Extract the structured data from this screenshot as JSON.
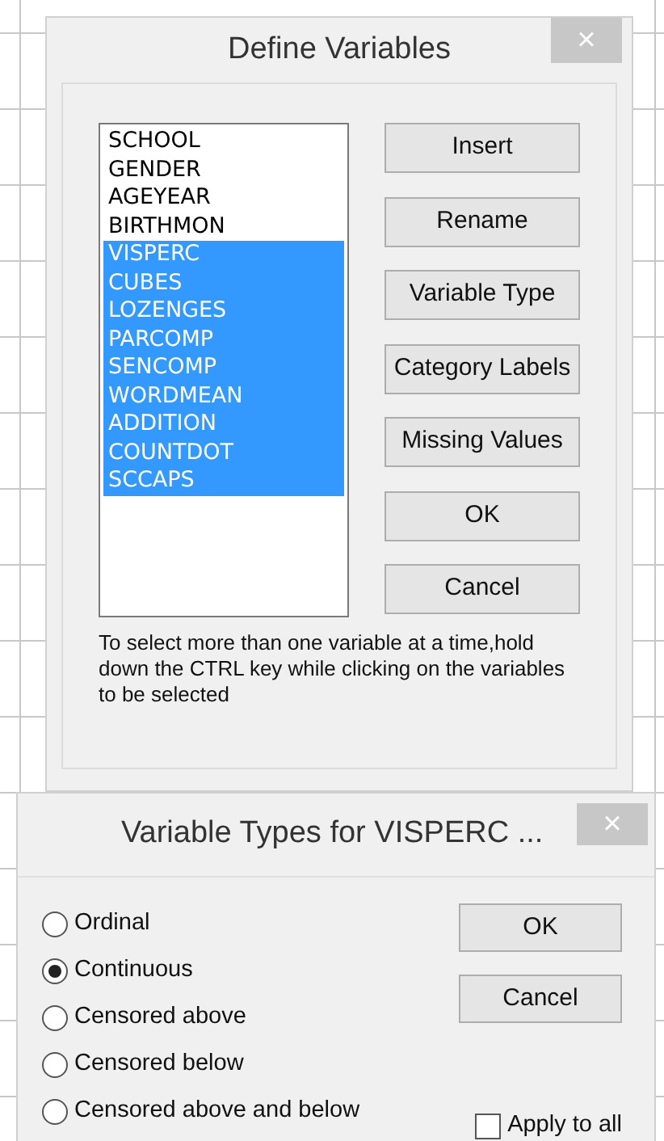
{
  "define_dialog": {
    "title": "Define Variables",
    "close": "×",
    "variables": [
      {
        "name": "SCHOOL",
        "selected": false
      },
      {
        "name": "GENDER",
        "selected": false
      },
      {
        "name": "AGEYEAR",
        "selected": false
      },
      {
        "name": "BIRTHMON",
        "selected": false
      },
      {
        "name": "VISPERC",
        "selected": true
      },
      {
        "name": "CUBES",
        "selected": true
      },
      {
        "name": "LOZENGES",
        "selected": true
      },
      {
        "name": "PARCOMP",
        "selected": true
      },
      {
        "name": "SENCOMP",
        "selected": true
      },
      {
        "name": "WORDMEAN",
        "selected": true
      },
      {
        "name": "ADDITION",
        "selected": true
      },
      {
        "name": "COUNTDOT",
        "selected": true
      },
      {
        "name": "SCCAPS",
        "selected": true
      }
    ],
    "buttons": [
      "Insert",
      "Rename",
      "Variable Type",
      "Category Labels",
      "Missing Values",
      "OK",
      "Cancel"
    ],
    "hint": "To select more than one variable at a time,hold down the CTRL key while clicking on the variables to be selected"
  },
  "types_dialog": {
    "title": "Variable Types for VISPERC ...",
    "close": "×",
    "options": [
      {
        "label": "Ordinal",
        "selected": false
      },
      {
        "label": "Continuous",
        "selected": true
      },
      {
        "label": "Censored above",
        "selected": false
      },
      {
        "label": "Censored below",
        "selected": false
      },
      {
        "label": "Censored above and below",
        "selected": false
      }
    ],
    "buttons": [
      "OK",
      "Cancel"
    ],
    "apply_to_all": {
      "label": "Apply to all",
      "checked": false
    }
  }
}
